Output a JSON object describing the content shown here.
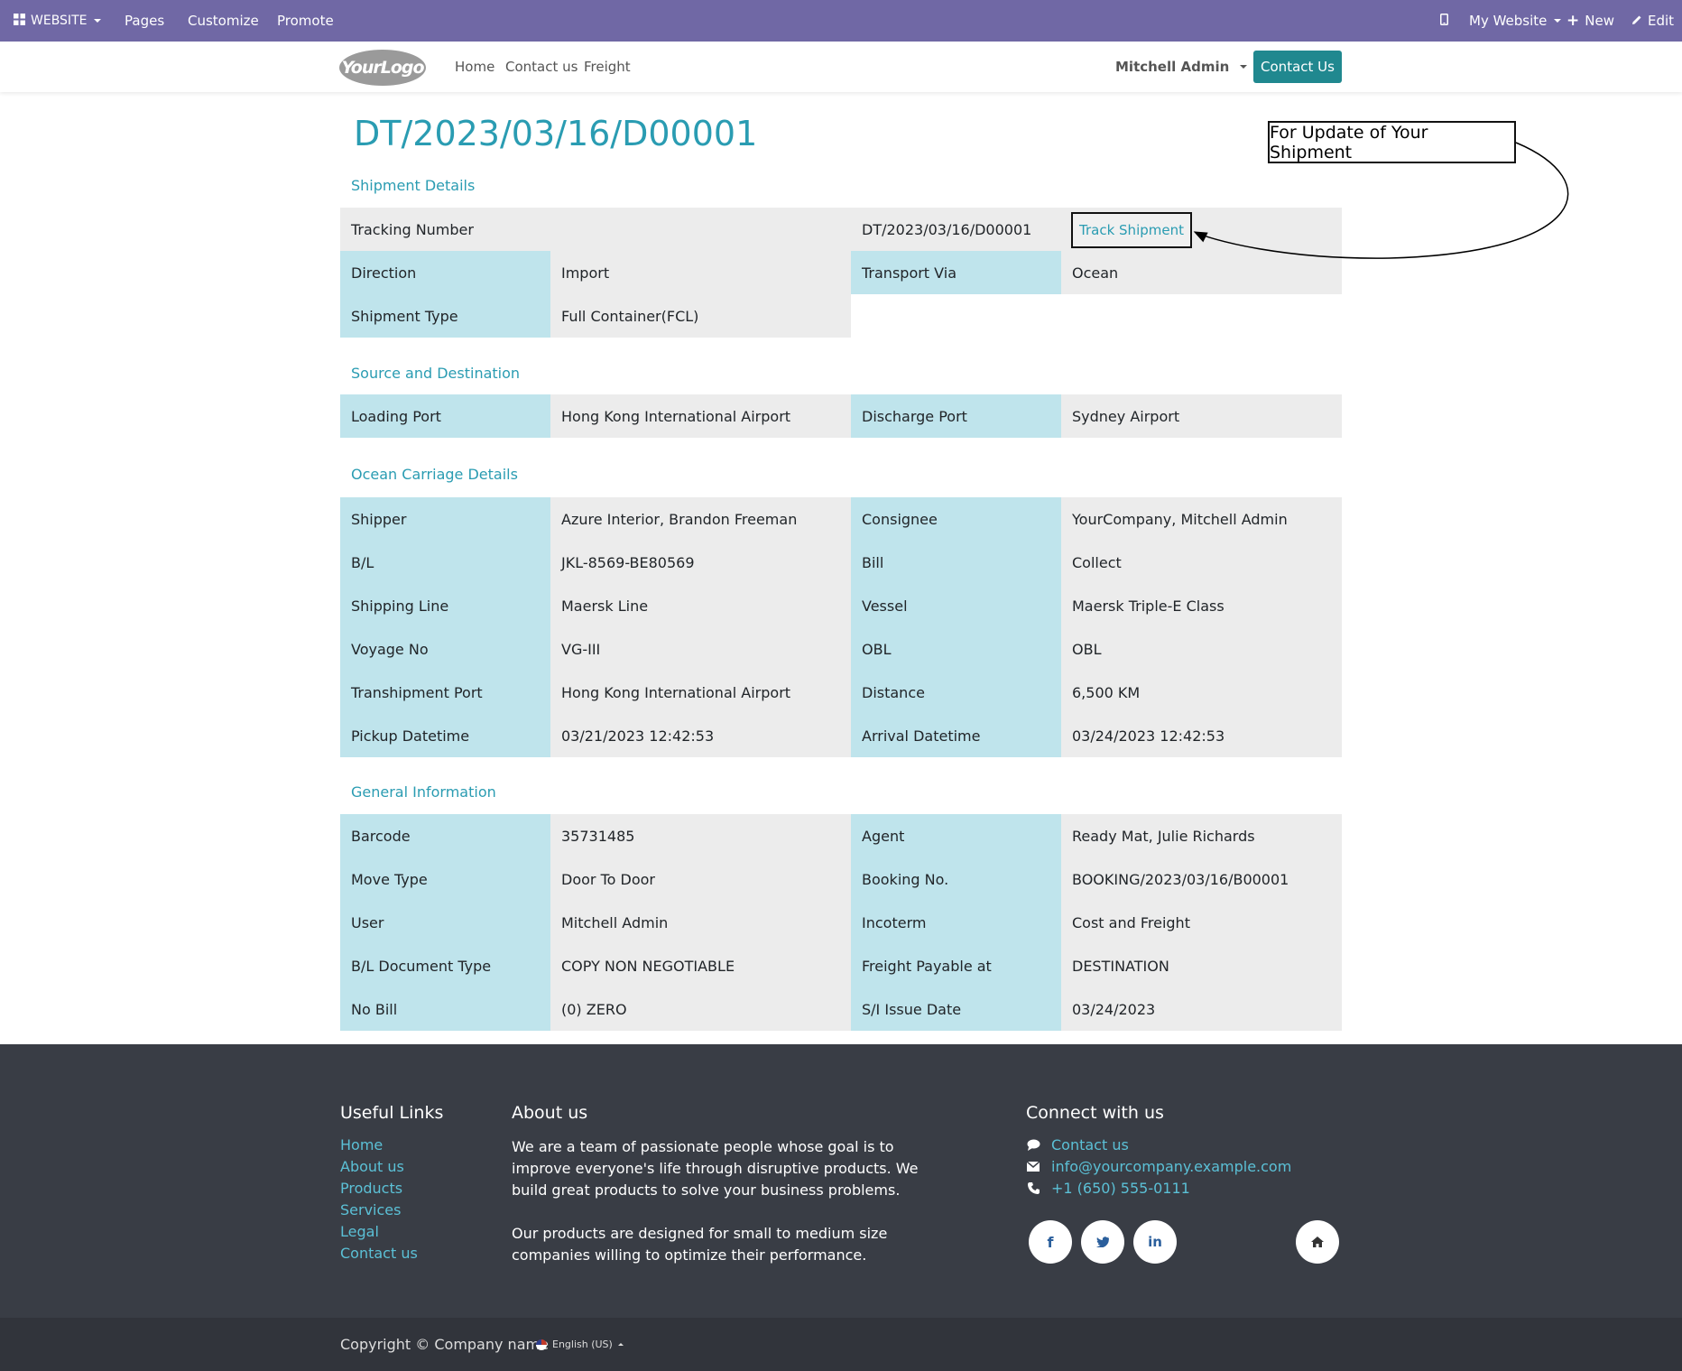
{
  "admin_bar": {
    "website": "WEBSITE",
    "pages": "Pages",
    "customize": "Customize",
    "promote": "Promote",
    "my_website": "My Website",
    "new": "New",
    "edit": "Edit"
  },
  "header": {
    "logo_text": "YourLogo",
    "nav": [
      "Home",
      "Contact us",
      "Freight"
    ],
    "user": "Mitchell Admin",
    "contact_button": "Contact Us"
  },
  "doc_title": "DT/2023/03/16/D00001",
  "annotation": {
    "callout": "For Update of Your Shipment"
  },
  "shipment": {
    "title": "Shipment Details",
    "tracking_label": "Tracking Number",
    "tracking_value": "DT/2023/03/16/D00001",
    "track_button": "Track Shipment",
    "direction_label": "Direction",
    "direction_value": "Import",
    "transport_label": "Transport Via",
    "transport_value": "Ocean",
    "type_label": "Shipment Type",
    "type_value": "Full Container(FCL)"
  },
  "source": {
    "title": "Source and Destination",
    "loading_label": "Loading Port",
    "loading_value": "Hong Kong International Airport",
    "discharge_label": "Discharge Port",
    "discharge_value": "Sydney Airport"
  },
  "ocean": {
    "title": "Ocean Carriage Details",
    "rows": [
      [
        "Shipper",
        "Azure Interior, Brandon Freeman",
        "Consignee",
        "YourCompany, Mitchell Admin"
      ],
      [
        "B/L",
        "JKL-8569-BE80569",
        "Bill",
        "Collect"
      ],
      [
        "Shipping Line",
        "Maersk Line",
        "Vessel",
        "Maersk Triple-E Class"
      ],
      [
        "Voyage No",
        "VG-III",
        "OBL",
        "OBL"
      ],
      [
        "Transhipment Port",
        "Hong Kong International Airport",
        "Distance",
        "6,500 KM"
      ],
      [
        "Pickup Datetime",
        "03/21/2023 12:42:53",
        "Arrival Datetime",
        "03/24/2023 12:42:53"
      ]
    ]
  },
  "general": {
    "title": "General Information",
    "rows": [
      [
        "Barcode",
        "35731485",
        "Agent",
        "Ready Mat, Julie Richards"
      ],
      [
        "Move Type",
        "Door To Door",
        "Booking No.",
        "BOOKING/2023/03/16/B00001"
      ],
      [
        "User",
        "Mitchell Admin",
        "Incoterm",
        "Cost and Freight"
      ],
      [
        "B/L Document Type",
        "COPY NON NEGOTIABLE",
        "Freight Payable at",
        "DESTINATION"
      ],
      [
        "No Bill",
        "(0) ZERO",
        "S/I Issue Date",
        "03/24/2023"
      ]
    ]
  },
  "footer": {
    "useful_links_title": "Useful Links",
    "useful_links": [
      "Home",
      "About us",
      "Products",
      "Services",
      "Legal",
      "Contact us"
    ],
    "about_title": "About us",
    "about_p1": "We are a team of passionate people whose goal is to improve everyone's life through disruptive products. We build great products to solve your business problems.",
    "about_p2": "Our products are designed for small to medium size companies willing to optimize their performance.",
    "connect_title": "Connect with us",
    "contact_us": "Contact us",
    "email": "info@yourcompany.example.com",
    "phone": "+1 (650) 555-0111",
    "copyright": "Copyright © Company name",
    "language": "English (US)"
  }
}
